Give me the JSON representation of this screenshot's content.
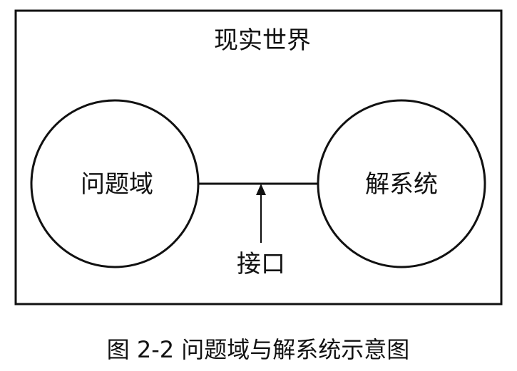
{
  "diagram": {
    "frame_title": "现实世界",
    "left_node": "问题域",
    "right_node": "解系统",
    "interface_label": "接口"
  },
  "caption": {
    "figure_number": "图 2-2",
    "text": "问题域与解系统示意图"
  }
}
